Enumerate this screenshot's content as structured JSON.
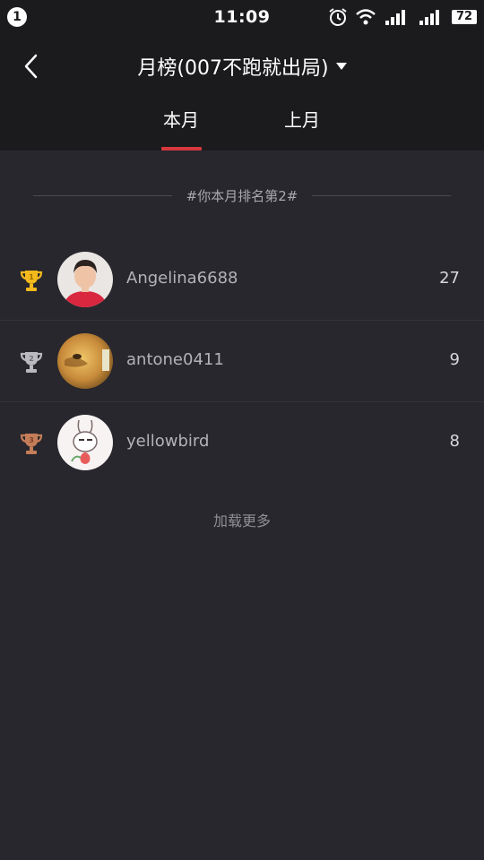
{
  "status_bar": {
    "notification_count": "1",
    "time": "11:09",
    "battery": "72",
    "icons": [
      "alarm-icon",
      "wifi-icon",
      "signal-1-icon",
      "signal-2-icon"
    ]
  },
  "header": {
    "title": "月榜(007不跑就出局)",
    "back_icon": "back-chevron-icon",
    "dropdown_icon": "triangle-down-icon"
  },
  "tabs": [
    {
      "label": "本月",
      "active": true
    },
    {
      "label": "上月",
      "active": false
    }
  ],
  "rank_banner": "#你本月排名第2#",
  "leaderboard": [
    {
      "rank": 1,
      "trophy": "gold-trophy-icon",
      "name": "Angelina6688",
      "score": "27"
    },
    {
      "rank": 2,
      "trophy": "silver-trophy-icon",
      "name": "antone0411",
      "score": "9"
    },
    {
      "rank": 3,
      "trophy": "bronze-trophy-icon",
      "name": "yellowbird",
      "score": "8"
    }
  ],
  "load_more": "加载更多",
  "colors": {
    "background": "#28272d",
    "header_bg": "#1b1b1e",
    "accent": "#d6383d",
    "gold": "#f3b91c",
    "silver": "#b9b9bf",
    "bronze": "#c47d58"
  }
}
